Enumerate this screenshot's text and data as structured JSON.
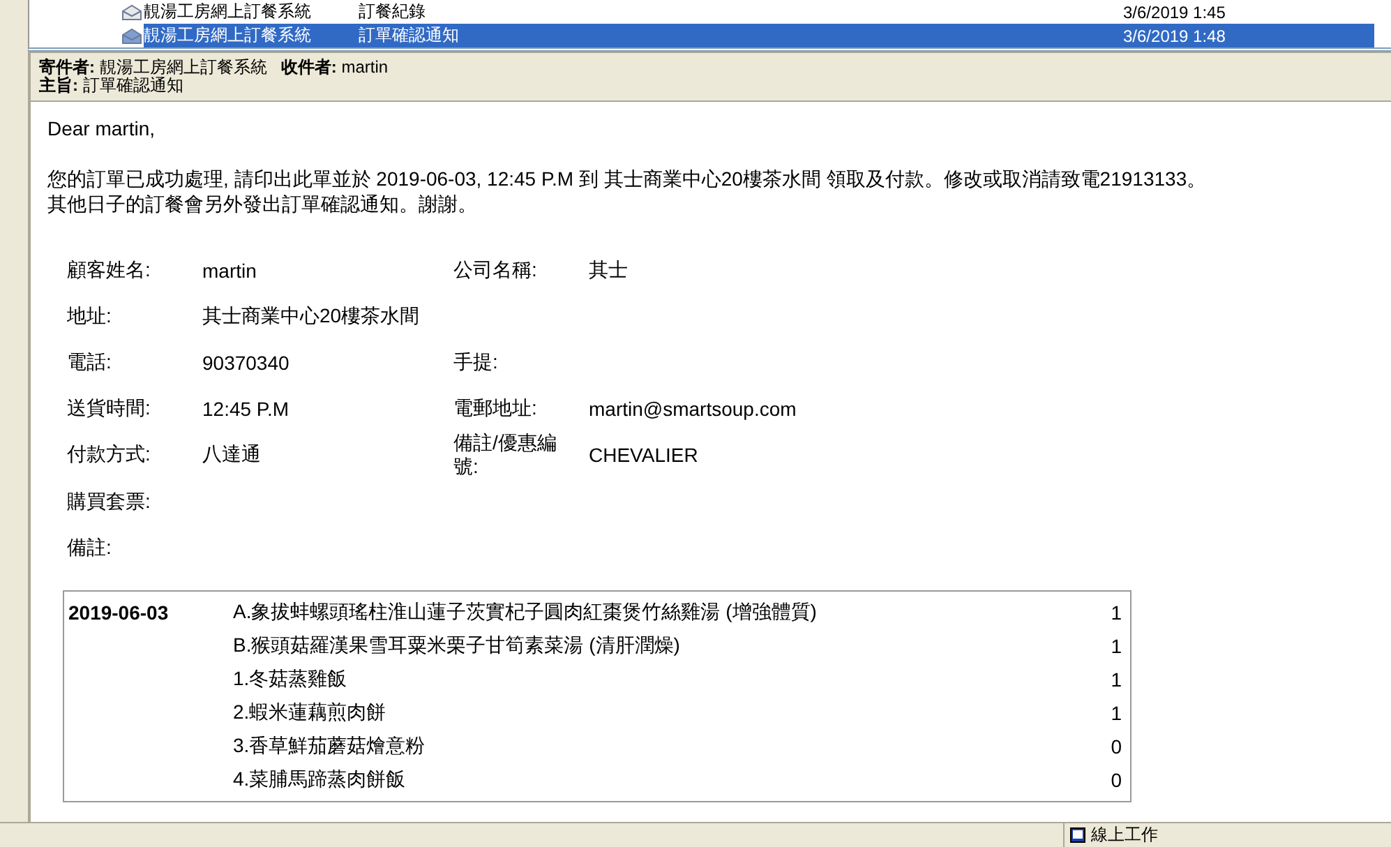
{
  "messages": [
    {
      "sender": "靚湯工房網上訂餐系統",
      "subject": "訂餐紀錄",
      "date": "3/6/2019 1:45",
      "selected": false
    },
    {
      "sender": "靚湯工房網上訂餐系統",
      "subject": "訂單確認通知",
      "date": "3/6/2019 1:48",
      "selected": true
    }
  ],
  "header": {
    "from_label": "寄件者:",
    "from": "靚湯工房網上訂餐系統",
    "to_label": "收件者:",
    "to": "martin",
    "subject_label": "主旨:",
    "subject": "訂單確認通知"
  },
  "body": {
    "greeting": "Dear martin,",
    "paragraph_lines": [
      "您的訂單已成功處理, 請印出此單並於 2019-06-03, 12:45 P.M 到 其士商業中心20樓茶水間 領取及付款。修改或取消請致電21913133。",
      "其他日子的訂餐會另外發出訂單確認通知。謝謝。"
    ],
    "fields": [
      [
        {
          "label": "顧客姓名:",
          "value": "martin"
        },
        {
          "label": "公司名稱:",
          "value": "其士"
        }
      ],
      [
        {
          "label": "地址:",
          "value": "其士商業中心20樓茶水間"
        }
      ],
      [
        {
          "label": "電話:",
          "value": "90370340"
        },
        {
          "label": "手提:"
        }
      ],
      [
        {
          "label": "送貨時間:",
          "value": "12:45 P.M"
        },
        {
          "label": "電郵地址:",
          "value": "martin@smartsoup.com"
        }
      ],
      [
        {
          "label": "付款方式:",
          "value": "八達通"
        },
        {
          "label": "備註/優惠編號:",
          "value": "CHEVALIER"
        }
      ],
      [
        {
          "label": "購買套票:"
        }
      ],
      [
        {
          "label": "備註:"
        }
      ]
    ],
    "order": {
      "date": "2019-06-03",
      "items": [
        {
          "name": "A.象拔蚌螺頭瑤柱淮山蓮子茨實杞子圓肉紅棗煲竹絲雞湯 (增強體質)",
          "qty": "1"
        },
        {
          "name": "B.猴頭菇羅漢果雪耳粟米栗子甘筍素菜湯 (清肝潤燥)",
          "qty": "1"
        },
        {
          "name": "1.冬菇蒸雞飯",
          "qty": "1"
        },
        {
          "name": "2.蝦米蓮藕煎肉餅",
          "qty": "1"
        },
        {
          "name": "3.香草鮮茄蘑菇燴意粉",
          "qty": "0"
        },
        {
          "name": "4.菜脯馬蹄蒸肉餅飯",
          "qty": "0"
        }
      ]
    }
  },
  "status_bar": {
    "text": "線上工作"
  }
}
